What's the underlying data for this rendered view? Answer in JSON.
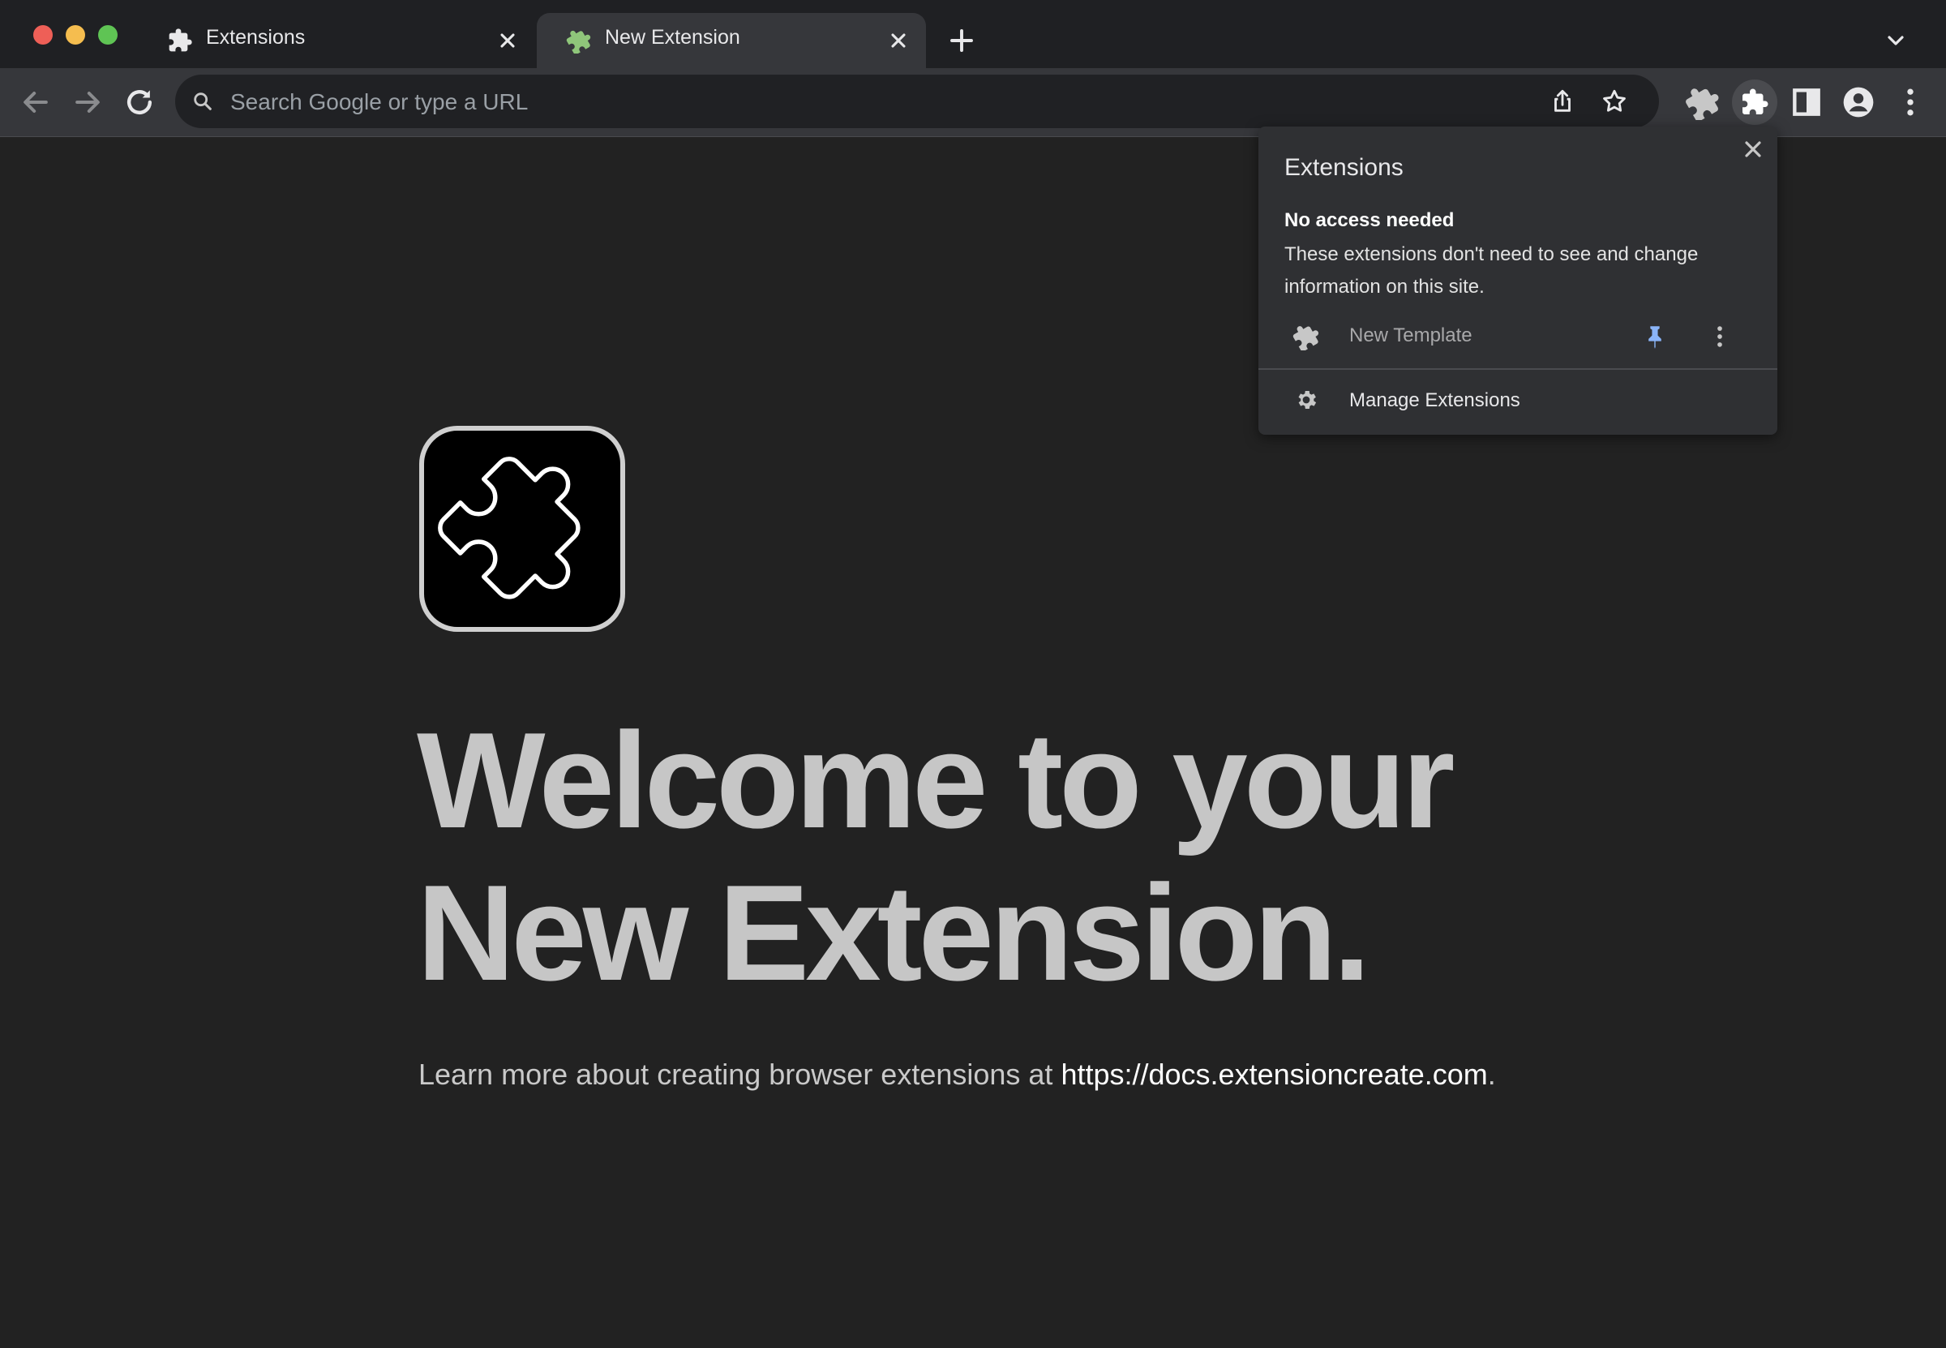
{
  "tabs": [
    {
      "title": "Extensions"
    },
    {
      "title": "New Extension"
    }
  ],
  "omnibox": {
    "placeholder": "Search Google or type a URL"
  },
  "page": {
    "heading_line1": "Welcome to your",
    "heading_line2": "New Extension.",
    "learn_text": "Learn more about creating browser extensions at ",
    "learn_link": "https://docs.extensioncreate.com",
    "learn_suffix": "."
  },
  "extensions_popup": {
    "title": "Extensions",
    "subheading": "No access needed",
    "description": "These extensions don't need to see and change information on this site.",
    "extension_item": {
      "name": "New Template"
    },
    "manage_label": "Manage Extensions"
  },
  "colors": {
    "background": "#222222",
    "toolbar": "#36373b",
    "tabstrip": "#1f2023",
    "pin_accent": "#8ab4f8",
    "ext_icon_green": "#8fc67a"
  },
  "icons": {
    "tab_1": "puzzle-icon",
    "tab_2": "puzzle-green-icon",
    "toolbar": [
      "back-icon",
      "forward-icon",
      "reload-icon",
      "search-icon",
      "share-icon",
      "star-icon",
      "extension-template-icon",
      "extensions-icon",
      "side-panel-icon",
      "profile-icon",
      "menu-icon"
    ]
  }
}
